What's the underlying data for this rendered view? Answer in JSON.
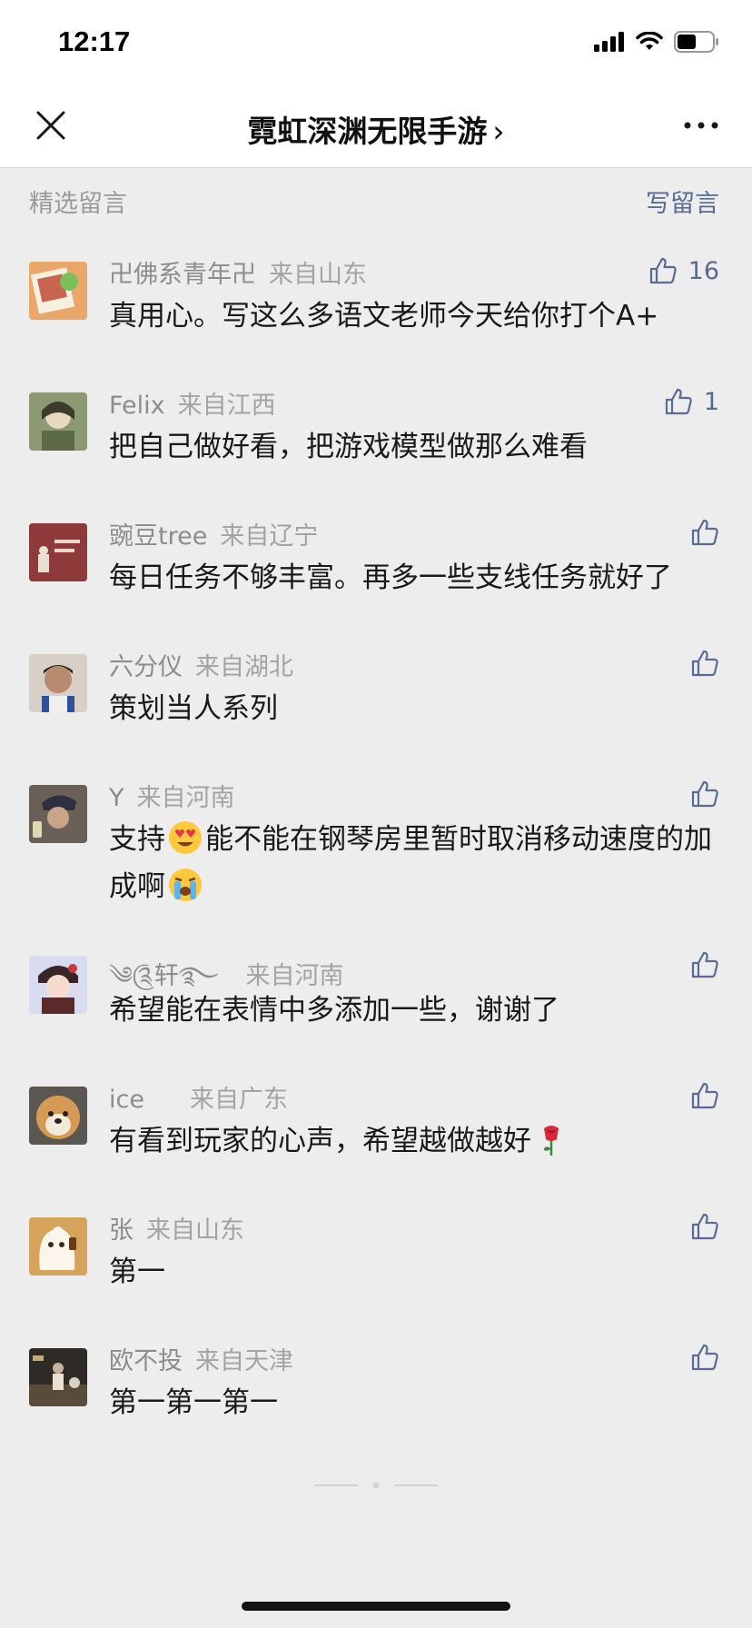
{
  "status": {
    "time": "12:17"
  },
  "nav": {
    "title": "霓虹深渊无限手游",
    "chevron": "›"
  },
  "section": {
    "title": "精选留言",
    "write_label": "写留言"
  },
  "comments": [
    {
      "name": "卍佛系青年卍",
      "location": "来自山东",
      "text": "真用心。写这么多语文老师今天给你打个A+",
      "likes": "16",
      "avatar_color": "#c86450"
    },
    {
      "name": "Felix",
      "location": "来自江西",
      "text": "把自己做好看，把游戏模型做那么难看",
      "likes": "1",
      "avatar_color": "#7a8b62"
    },
    {
      "name": "豌豆tree",
      "location": "来自辽宁",
      "text": "每日任务不够丰富。再多一些支线任务就好了",
      "likes": "",
      "avatar_color": "#8e3a3a",
      "avatar_text": "小刘说情"
    },
    {
      "name": "六分仪",
      "location": "来自湖北",
      "text": "策划当人系列",
      "likes": "",
      "avatar_color": "#a08070"
    },
    {
      "name": "Y",
      "location": "来自河南",
      "text_a": "支持",
      "text_b": "能不能在钢琴房里暂时取消移动速度的加成啊",
      "likes": "",
      "avatar_color": "#5a5048",
      "emoji_1": "heart-eyes-emoji",
      "emoji_2": "crying-emoji"
    },
    {
      "name": "༄༊轩࿐",
      "location": "来自河南",
      "text": "希望能在表情中多添加一些，谢谢了",
      "likes": "",
      "avatar_color": "#3a2a3a"
    },
    {
      "name": "ice",
      "location": "来自广东",
      "text": "有看到玩家的心声，希望越做越好",
      "likes": "",
      "avatar_color": "#d79a55",
      "emoji": "rose-emoji"
    },
    {
      "name": "张",
      "location": "来自山东",
      "text": "第一",
      "likes": "",
      "avatar_color": "#d6a35a"
    },
    {
      "name": "欧不投",
      "location": "来自天津",
      "text": "第一第一第一",
      "likes": "",
      "avatar_color": "#3b332c"
    }
  ],
  "colors": {
    "link": "#576b95",
    "background": "#ededed"
  }
}
